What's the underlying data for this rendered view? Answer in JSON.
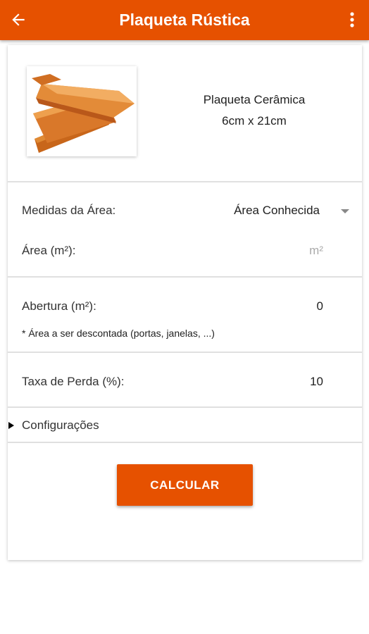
{
  "appbar": {
    "title": "Plaqueta Rústica",
    "back_icon": "arrow-left-icon",
    "menu_icon": "more-vert-icon",
    "color": "#e65100"
  },
  "product": {
    "image_icon": "ceramic-tile-image",
    "name_line1": "Plaqueta Cerâmica",
    "name_line2": "6cm x 21cm"
  },
  "area": {
    "label": "Medidas da Área:",
    "mode_value": "Área Conhecida",
    "area_label": "Área (m²):",
    "area_placeholder": "m²"
  },
  "opening": {
    "label": "Abertura (m²):",
    "value": "0",
    "note": "* Área a ser descontada (portas, janelas, ...)"
  },
  "loss": {
    "label": "Taxa de Perda (%):",
    "value": "10"
  },
  "settings": {
    "label": "Configurações"
  },
  "actions": {
    "calculate_label": "CALCULAR"
  }
}
